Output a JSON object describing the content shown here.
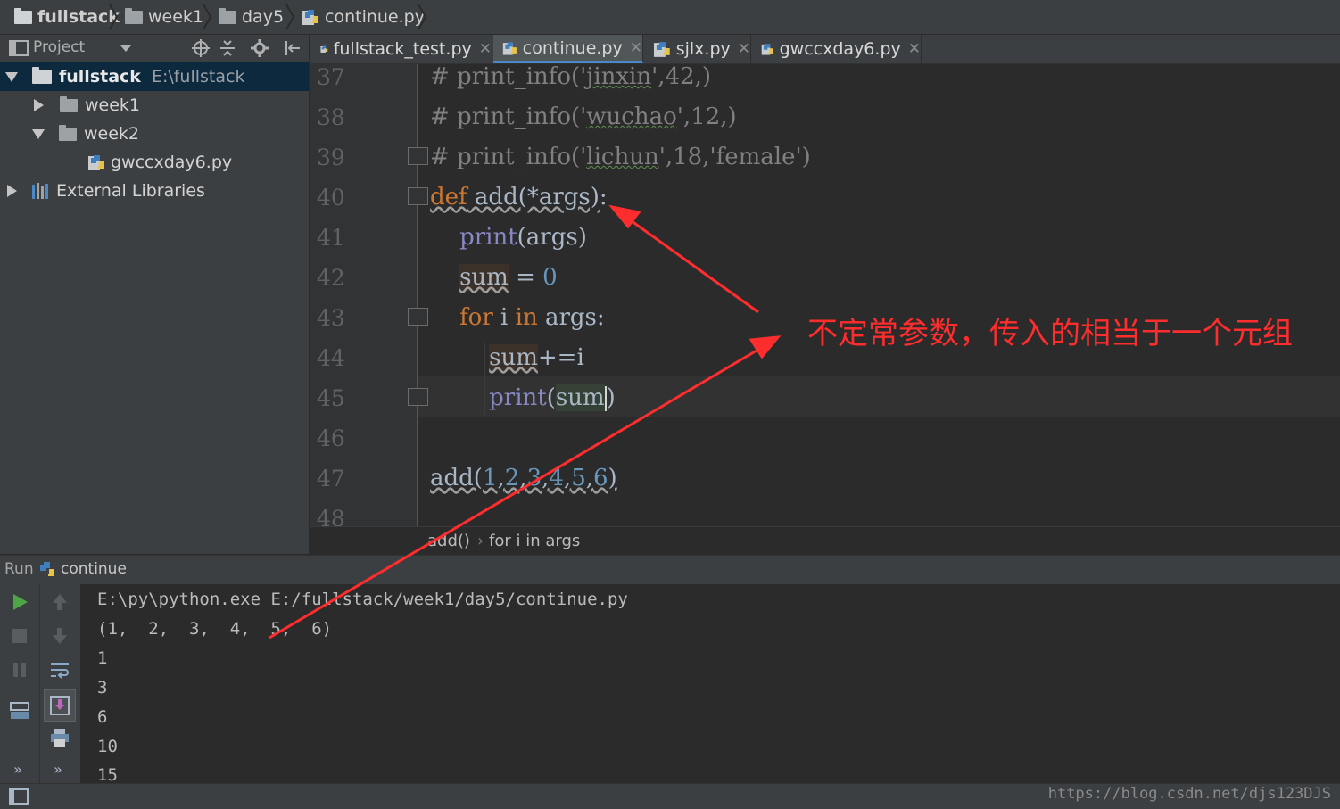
{
  "breadcrumb": [
    "fullstack",
    "week1",
    "day5",
    "continue.py"
  ],
  "project_panel": {
    "title": "Project",
    "tree": [
      {
        "label": "fullstack",
        "path": "E:\\fullstack",
        "expanded": true,
        "selected": true
      },
      {
        "label": "week1",
        "expanded": false
      },
      {
        "label": "week2",
        "expanded": true
      },
      {
        "label": "gwccxday6.py"
      },
      {
        "label": "External Libraries",
        "expanded": false
      }
    ]
  },
  "tabs": [
    {
      "label": "fullstack_test.py",
      "active": false
    },
    {
      "label": "continue.py",
      "active": true
    },
    {
      "label": "sjlx.py",
      "active": false
    },
    {
      "label": "gwccxday6.py",
      "active": false
    }
  ],
  "editor": {
    "line_numbers": [
      "37",
      "38",
      "39",
      "40",
      "41",
      "42",
      "43",
      "44",
      "45",
      "46",
      "47",
      "48"
    ],
    "current_line": "45"
  },
  "editor_breadcrumb": [
    "add()",
    "for i in args"
  ],
  "run": {
    "label": "Run",
    "config": "continue",
    "output": [
      "E:\\py\\python.exe E:/fullstack/week1/day5/continue.py",
      "(1,  2,  3,  4,  5,  6)",
      "1",
      "3",
      "6",
      "10",
      "15"
    ]
  },
  "annotation": "不定常参数，传入的相当于一个元组",
  "watermark": "https://blog.csdn.net/djs123DJS",
  "colors": {
    "annotation": "#ff2d2d",
    "keyword": "#cc7832",
    "number": "#6897bb",
    "builtin": "#8888c6",
    "comment": "#808080"
  }
}
